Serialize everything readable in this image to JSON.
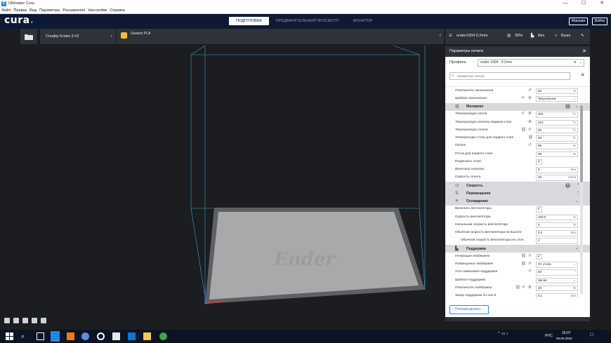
{
  "window": {
    "title": "Ultimaker Cura",
    "controls": [
      "—",
      "☐",
      "✕"
    ]
  },
  "menu": [
    "Файл",
    "Правка",
    "Вид",
    "Параметры",
    "Расширения",
    "Настройки",
    "Справка"
  ],
  "header": {
    "logo": "cura",
    "logo_dot": ".",
    "tabs": [
      "ПОДГОТОВКА",
      "ПРЕДВАРИТЕЛЬНЫЙ ПРОСМОТР",
      "МОНИТОР"
    ],
    "marketplace_label": "Магазин",
    "signin_label": "Войти"
  },
  "toolbar": {
    "printer": "Creality Ender-3 #2",
    "material": "Generic PLA",
    "profile_summary": "ender1504 0.2mm",
    "infill": "30%",
    "support": "Вкл",
    "adhesion": "Выкл"
  },
  "panel": {
    "title": "Параметры печати",
    "profile_label": "Профиль",
    "profile_value": "ender 1504 - 0.2mm",
    "search_placeholder": "параметры поиска",
    "recommended_label": "Рекомендован"
  },
  "settings": {
    "infill_density": {
      "label": "Плотность заполнения",
      "value": "50",
      "unit": "%"
    },
    "infill_pattern": {
      "label": "Шаблон заполнения",
      "value": "Треугольник"
    },
    "material_cat": "Материал",
    "nozzle_temp": {
      "label": "Температура сопла",
      "value": "204",
      "unit": "°C"
    },
    "nozzle_temp_first": {
      "label": "Температура печати первого слоя",
      "value": "210",
      "unit": "°C"
    },
    "bed_temp": {
      "label": "Температура стола",
      "value": "50",
      "unit": "°C"
    },
    "bed_temp_first": {
      "label": "Температура стола для первого слоя",
      "value": "60",
      "unit": "°C"
    },
    "flow": {
      "label": "Поток",
      "value": "96",
      "unit": "%"
    },
    "flow_first": {
      "label": "Поток для первого слоя",
      "value": "98",
      "unit": "%"
    },
    "retract_enable": {
      "label": "Разрешить откат",
      "check": "✓"
    },
    "retract_dist": {
      "label": "Величина отката",
      "value": "5",
      "unit": "mm"
    },
    "retract_speed": {
      "label": "Скорость отката",
      "value": "40",
      "unit": "mm/s"
    },
    "speed_cat": "Скорость",
    "travel_cat": "Перемещение",
    "cooling_cat": "Охлаждение",
    "fan_enable": {
      "label": "Включить вентиляторы",
      "check": "✓"
    },
    "fan_speed": {
      "label": "Скорость вентилятора",
      "value": "100.0",
      "unit": "%"
    },
    "fan_initial": {
      "label": "Начальная скорость вентилятора",
      "value": "0",
      "unit": "%"
    },
    "fan_full_height": {
      "label": "Обычная скорость вентилятора на высоте",
      "value": "0.2",
      "unit": "mm"
    },
    "fan_full_layer": {
      "label": "Обычная скорость вентилятора на слое",
      "value": "2"
    },
    "support_cat": "Поддержки",
    "support_enable": {
      "label": "Генерация поддержек",
      "check": "✓"
    },
    "support_type": {
      "label": "Размещение поддержек",
      "value": "От стола"
    },
    "support_angle": {
      "label": "Угол нависания поддержки",
      "value": "50",
      "unit": "°"
    },
    "support_pattern": {
      "label": "Шаблон поддержек",
      "value": "Зигзаг"
    },
    "support_density": {
      "label": "Плотность поддержки",
      "value": "20",
      "unit": "%"
    },
    "support_z": {
      "label": "Зазор поддержки по оси Z",
      "value": "0.1",
      "unit": "mm"
    }
  },
  "viewport": {
    "bed_logo": "Ender"
  },
  "taskbar": {
    "lang": "РУС",
    "time": "16:07",
    "date": "06.05.2019"
  },
  "colors": {
    "accent": "#3282ff",
    "header_bg": "#0e1a34",
    "material_badge": "#f3c21d"
  }
}
